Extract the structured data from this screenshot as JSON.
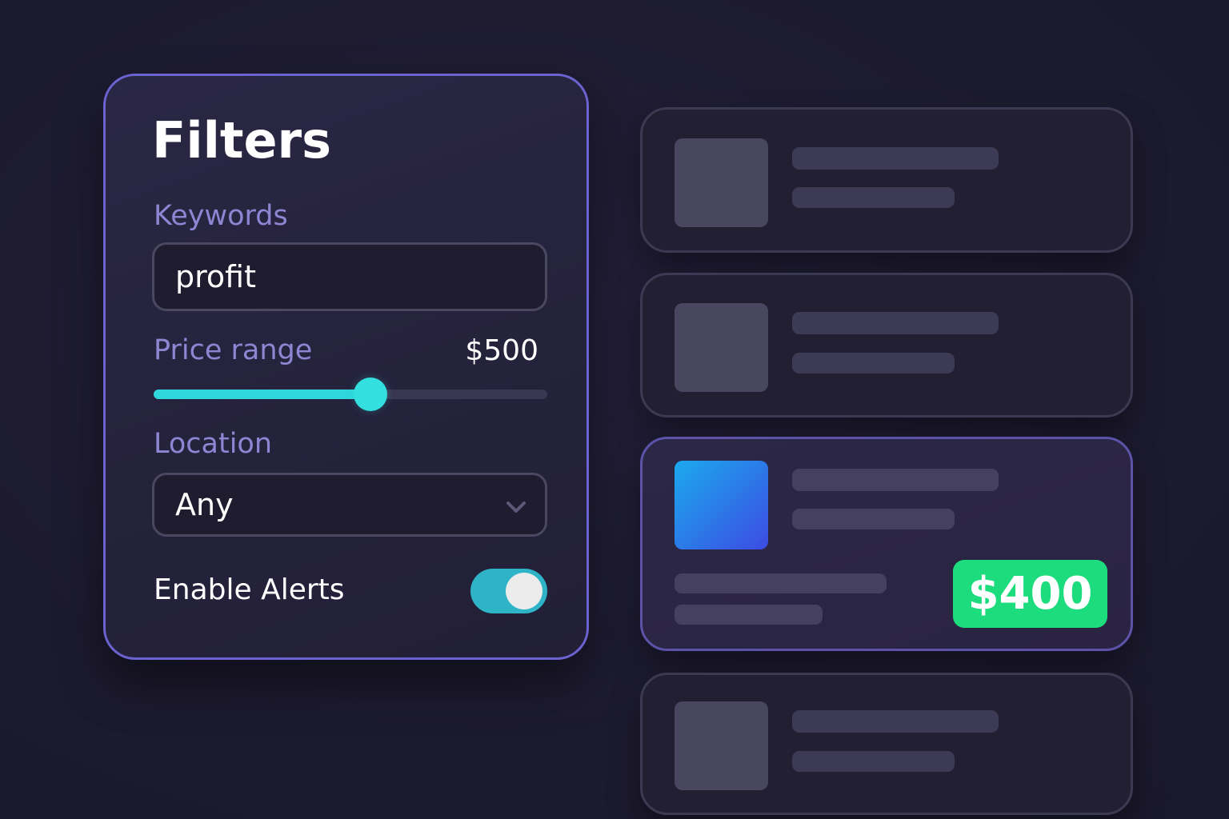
{
  "filters": {
    "title": "Filters",
    "keywords": {
      "label": "Keywords",
      "value": "profit"
    },
    "price_range": {
      "label": "Price range",
      "value_text": "$500",
      "slider_level": 0.55
    },
    "location": {
      "label": "Location",
      "selected": "Any"
    },
    "alerts": {
      "label": "Enable Alerts",
      "enabled": true
    }
  },
  "results": {
    "highlighted_price": "$400"
  },
  "colors": {
    "accent_border": "#6b63cf",
    "slider_accent": "#2fd7dc",
    "toggle_on": "#2fb3c6",
    "price_badge": "#1ddc7e",
    "label_text": "#8e86d2"
  },
  "icons": {
    "location_dropdown": "chevron-down-icon"
  }
}
